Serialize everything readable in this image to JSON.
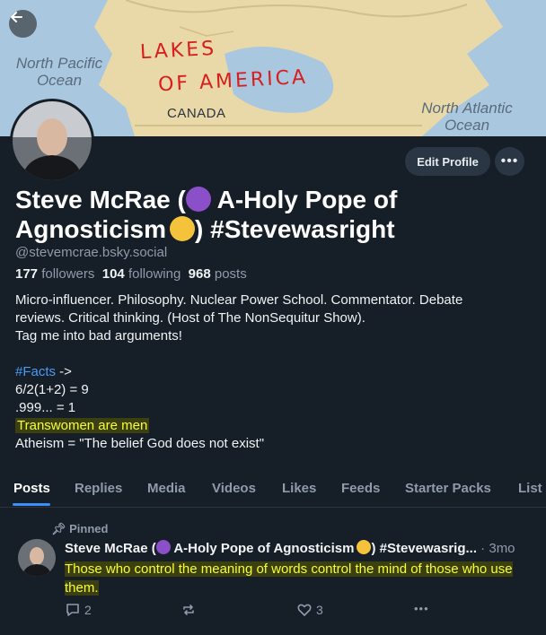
{
  "banner": {
    "labels": [
      "North Pacific Ocean",
      "North Atlantic Ocean",
      "CANADA"
    ],
    "pacific_line1": "North Pacific",
    "pacific_line2": "Ocean",
    "atlantic_line1": "North Atlantic",
    "atlantic_line2": "Ocean",
    "canada": "CANADA",
    "scribble_line1": "LAKES",
    "scribble_line2": "OF AMERICA"
  },
  "profile": {
    "name_part1": "Steve McRae (",
    "name_part2": " A-Holy Pope of",
    "name_part3": "Agnosticism",
    "name_part4": ") #Stevewasright",
    "handle": "@stevemcrae.bsky.social",
    "followers_count": "177",
    "followers_label": "followers",
    "following_count": "104",
    "following_label": "following",
    "posts_count": "968",
    "posts_label": "posts"
  },
  "buttons": {
    "edit_profile": "Edit Profile"
  },
  "bio": {
    "line1": "Micro-influencer. Philosophy. Nuclear Power School. Commentator. Debate",
    "line2": "reviews. Critical thinking. (Host of The NonSequitur Show).",
    "line3": "Tag me into bad arguments!",
    "hashtag": "#Facts",
    "hashtag_suffix": " ->",
    "fact1": "6/2(1+2) = 9",
    "fact2": ".999... = 1",
    "fact3": "Transwomen are men",
    "fact4": "Atheism = \"The belief God does not exist\""
  },
  "tabs": [
    "Posts",
    "Replies",
    "Media",
    "Videos",
    "Likes",
    "Feeds",
    "Starter Packs",
    "List"
  ],
  "post": {
    "pinned_label": "Pinned",
    "author_part1": "Steve McRae (",
    "author_part2": " A-Holy Pope of Agnosticism",
    "author_part3": ") #Stevewasrig...",
    "time": " · 3mo",
    "text": "Those who control the meaning of words control the mind of those who use them.",
    "reply_count": "2",
    "repost_count": "",
    "like_count": "3"
  },
  "colors": {
    "background": "#161e27",
    "accent": "#3d8ef5",
    "highlight": "#f4ff35",
    "scribble": "#d81e1e"
  }
}
